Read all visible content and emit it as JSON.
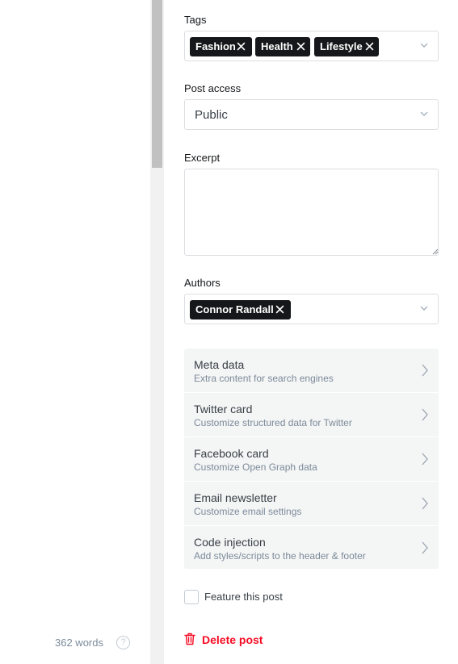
{
  "editor": {
    "word_count": "362 words",
    "help_glyph": "?"
  },
  "settings": {
    "tags": {
      "label": "Tags",
      "items": [
        "Fashion",
        "Health",
        "Lifestyle"
      ]
    },
    "post_access": {
      "label": "Post access",
      "value": "Public"
    },
    "excerpt": {
      "label": "Excerpt",
      "value": ""
    },
    "authors": {
      "label": "Authors",
      "items": [
        "Connor Randall"
      ]
    },
    "nav_items": [
      {
        "title": "Meta data",
        "subtitle": "Extra content for search engines"
      },
      {
        "title": "Twitter card",
        "subtitle": "Customize structured data for Twitter"
      },
      {
        "title": "Facebook card",
        "subtitle": "Customize Open Graph data"
      },
      {
        "title": "Email newsletter",
        "subtitle": "Customize email settings"
      },
      {
        "title": "Code injection",
        "subtitle": "Add styles/scripts to the header & footer"
      }
    ],
    "feature_post": {
      "label": "Feature this post",
      "checked": false
    },
    "delete": {
      "label": "Delete post",
      "color": "#f50b23"
    }
  },
  "colors": {
    "token_bg": "#15171a",
    "nav_bg": "#f4f5f5",
    "danger": "#f50b23"
  }
}
